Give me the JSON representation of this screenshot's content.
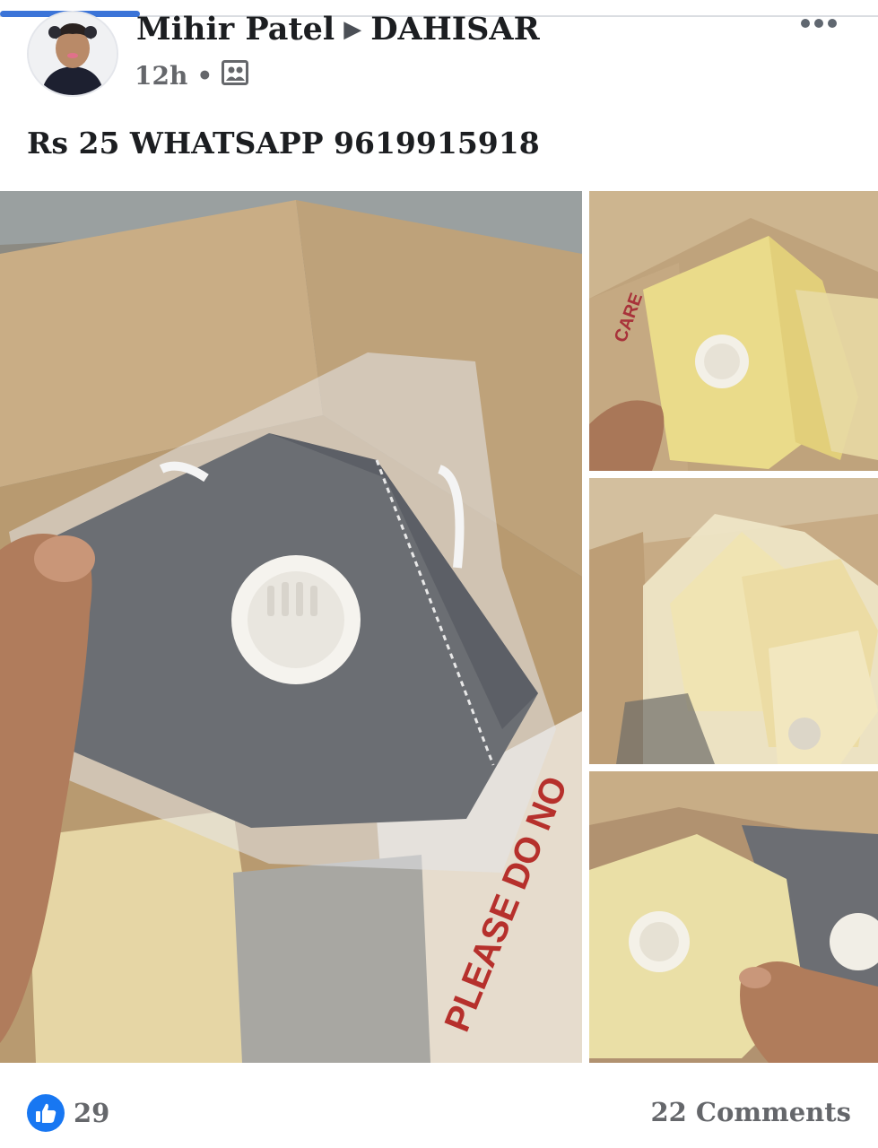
{
  "post": {
    "author": "Mihir Patel",
    "location": "DAHISAR",
    "time": "12h",
    "text": "Rs 25 WHATSAPP 9619915918",
    "icons": {
      "location_arrow": "triangle-right-icon",
      "audience": "group-icon",
      "more": "more-options-icon",
      "like": "like-thumb-icon"
    }
  },
  "photos": [
    {
      "name": "grey-valve-mask-photo",
      "print": "PLEASE DO NO"
    },
    {
      "name": "yellow-masks-box-photo",
      "print": "CARE"
    },
    {
      "name": "cream-masks-pile-photo",
      "print": ""
    },
    {
      "name": "mixed-masks-hand-photo",
      "print": ""
    }
  ],
  "footer": {
    "likes": "29",
    "comments": "22 Comments"
  },
  "colors": {
    "accent": "#1877f2",
    "cardboard": "#c7a980",
    "mask_grey": "#6b6e73",
    "mask_yellow": "#eadb8a"
  }
}
